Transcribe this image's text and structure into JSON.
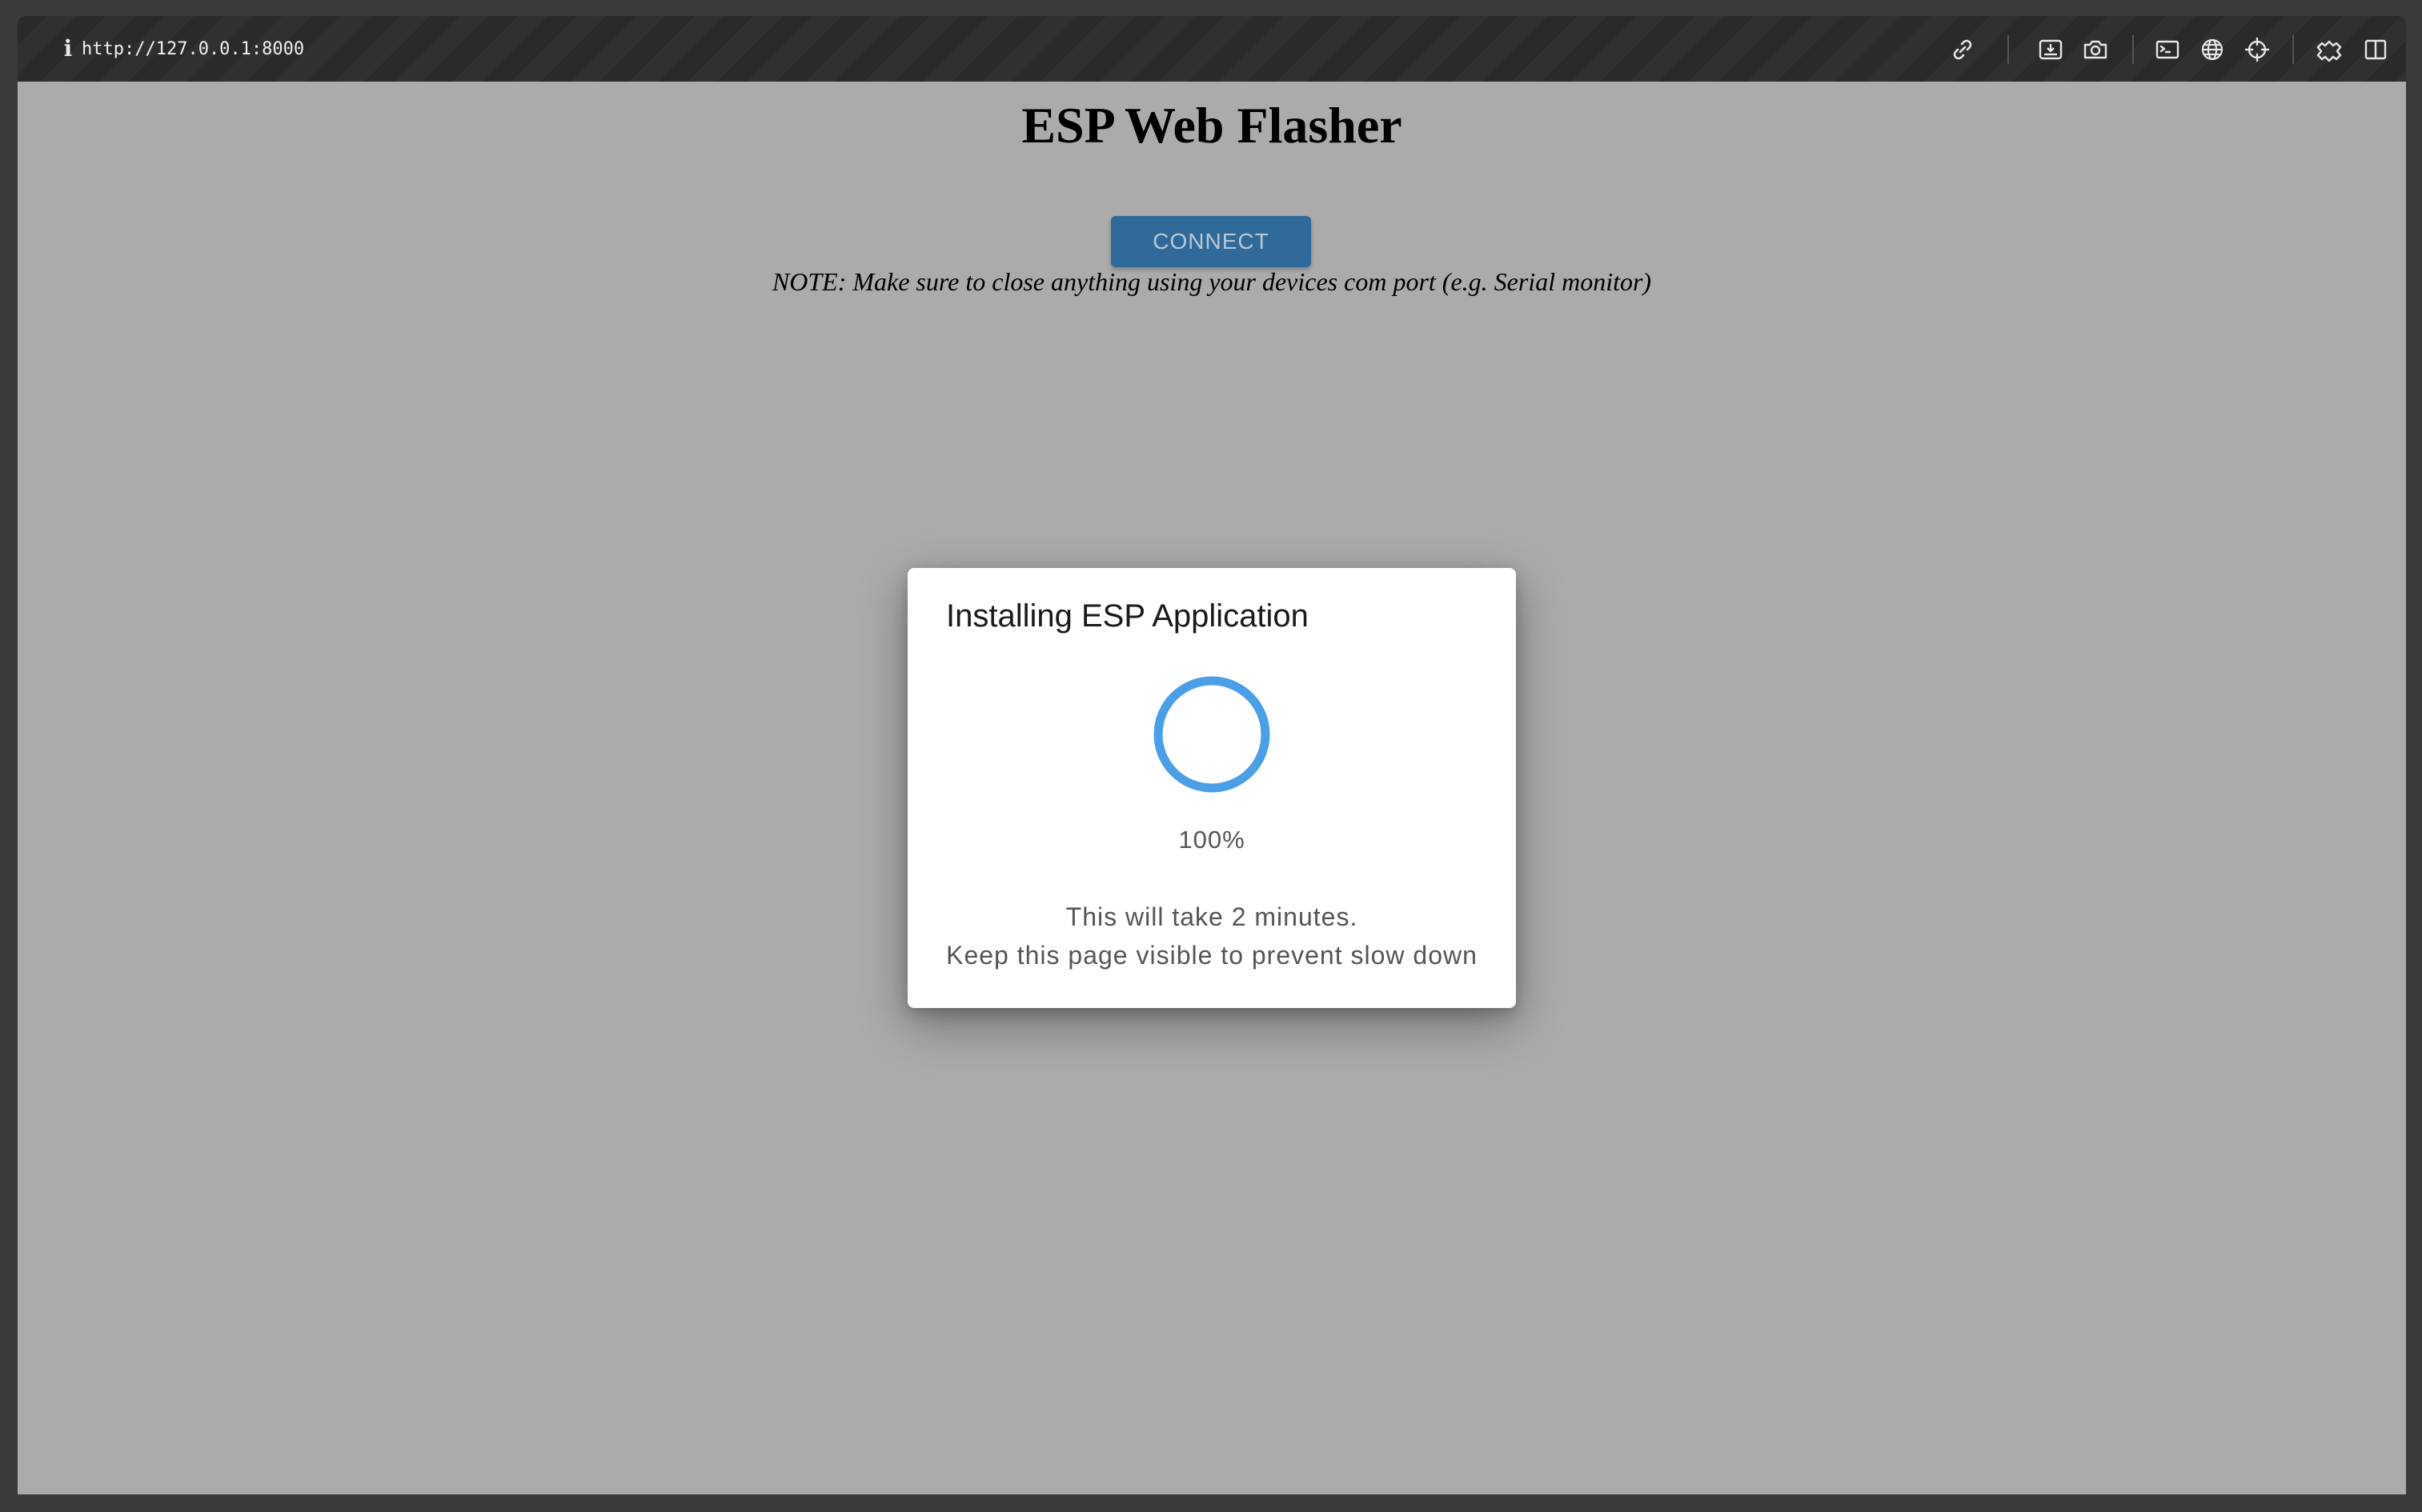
{
  "browser": {
    "url": "http://127.0.0.1:8000",
    "info_icon": "i",
    "toolbar_icons": [
      "link-icon",
      "download-icon",
      "camera-icon",
      "terminal-icon",
      "globe-icon",
      "crosshair-icon",
      "extension-icon",
      "split-view-icon"
    ]
  },
  "page": {
    "title": "ESP Web Flasher",
    "connect_label": "CONNECT",
    "note": "NOTE: Make sure to close anything using your devices com port (e.g. Serial monitor)"
  },
  "dialog": {
    "title": "Installing ESP Application",
    "progress_text": "100%",
    "progress_value": 1.0,
    "message_line1": "This will take 2 minutes.",
    "message_line2": "Keep this page visible to prevent slow down"
  },
  "colors": {
    "overlay_background": "#ababab",
    "accent": "#4a9fe6",
    "button": "#2f6a9a"
  }
}
